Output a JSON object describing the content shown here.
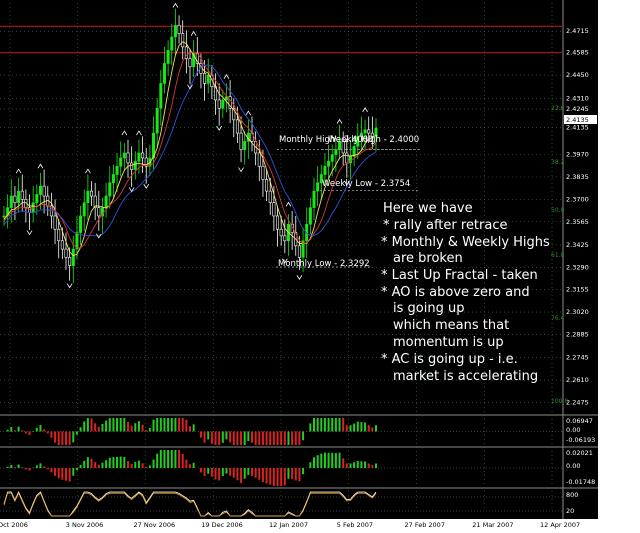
{
  "chart_data": {
    "type": "candlestick",
    "price_axis": {
      "min": 2.2411,
      "max": 2.4885,
      "tick_labels": [
        "2.4715",
        "2.4585",
        "2.4450",
        "2.4310",
        "2.4245",
        "2.4135",
        "2.3970",
        "2.3835",
        "2.3700",
        "2.3565",
        "2.3425",
        "2.3290",
        "2.3155",
        "2.3020",
        "2.2885",
        "2.2745",
        "2.2610",
        "2.2475"
      ]
    },
    "current_price": "2.4135",
    "date_labels": [
      "Oct 2006",
      "3 Nov 2006",
      "27 Nov 2006",
      "19 Dec 2006",
      "12 Jan 2007",
      "5 Feb 2007",
      "27 Feb 2007",
      "21 Mar 2007",
      "12 Apr 2007"
    ],
    "candles_close": [
      2.36,
      2.365,
      2.372,
      2.368,
      2.375,
      2.37,
      2.365,
      2.362,
      2.368,
      2.373,
      2.378,
      2.372,
      2.366,
      2.36,
      2.352,
      2.345,
      2.34,
      2.335,
      2.33,
      2.34,
      2.35,
      2.36,
      2.368,
      2.375,
      2.372,
      2.365,
      2.36,
      2.365,
      2.372,
      2.38,
      2.385,
      2.39,
      2.395,
      2.398,
      2.392,
      2.388,
      2.393,
      2.398,
      2.395,
      2.39,
      2.395,
      2.41,
      2.425,
      2.44,
      2.452,
      2.46,
      2.468,
      2.475,
      2.47,
      2.462,
      2.455,
      2.45,
      2.458,
      2.452,
      2.446,
      2.44,
      2.445,
      2.438,
      2.43,
      2.425,
      2.43,
      2.432,
      2.425,
      2.418,
      2.41,
      2.4,
      2.405,
      2.41,
      2.405,
      2.398,
      2.39,
      2.382,
      2.375,
      2.368,
      2.36,
      2.352,
      2.348,
      2.345,
      2.355,
      2.35,
      2.342,
      2.335,
      2.345,
      2.355,
      2.365,
      2.375,
      2.38,
      2.385,
      2.39,
      2.393,
      2.397,
      2.4,
      2.405,
      2.398,
      2.392,
      2.396,
      2.402,
      2.408,
      2.41,
      2.412,
      2.41,
      2.408,
      2.413
    ],
    "levels": [
      {
        "label": "Monthly High - 2.4000",
        "value": 2.4
      },
      {
        "label": "Weekly High - 2.4000",
        "value": 2.4
      },
      {
        "label": "Weekly Low - 2.3754",
        "value": 2.3754
      },
      {
        "label": "Monthly Low - 2.3292",
        "value": 2.3292
      }
    ],
    "fib_labels": [
      "23.6",
      "38.2",
      "50.0",
      "61.8",
      "76.4",
      "100.0"
    ],
    "resistance_lines": [
      2.4745,
      2.4585
    ],
    "indicators": [
      {
        "name": "AO",
        "tick_labels": [
          "0.06947",
          "0.00",
          "-0.06193"
        ]
      },
      {
        "name": "AC",
        "tick_labels": [
          "0.02021",
          "0.00",
          "-0.01748"
        ]
      },
      {
        "name": "Stochastic",
        "tick_labels": [
          "800",
          "20"
        ]
      }
    ]
  },
  "annotation": {
    "title": "Here we have",
    "lines": [
      "* rally after retrace",
      "* Monthly & Weekly Highs",
      "are broken",
      "* Last Up Fractal - taken",
      "* AO is above zero and",
      "is going up",
      "which means that",
      "momentum is up",
      "* AC is going up - i.e.",
      "market is accelerating"
    ]
  },
  "colors": {
    "background": "#000000",
    "grid": "#2f7f2f",
    "bull": "#17e817",
    "bear": "#ffffff",
    "ma_fast": "#f2e06a",
    "ma_mid": "#d53a2f",
    "ma_slow": "#3450d8",
    "resistance": "#cc1b1b",
    "stoch_main": "#ffffff",
    "stoch_signal": "#e8a020"
  }
}
